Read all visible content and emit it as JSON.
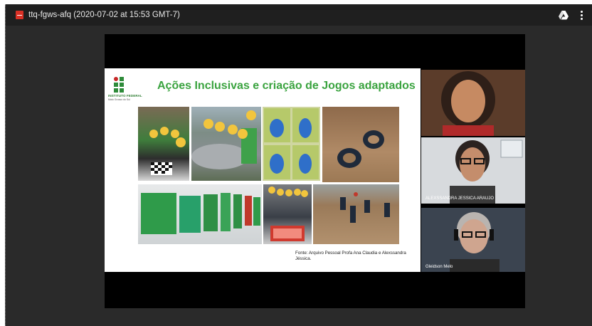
{
  "window": {
    "title": "ttq-fgws-afq (2020-07-02 at 15:53 GMT-7)",
    "file_icon": "recording-file-icon",
    "drive_icon": "google-drive-icon",
    "more_icon": "more-vert-icon"
  },
  "slide": {
    "logo_text": "INSTITUTO FEDERAL",
    "logo_subtext": "Mato Grosso do Sul",
    "title": "Ações  Inclusivas e criação de Jogos adaptados",
    "caption": "Fonte: Arquivo Pessoal Profa Ana Claudia e  Alexssandra Jéssica."
  },
  "participants": [
    {
      "name": "",
      "tile_color": "#6b4a35"
    },
    {
      "name": "ALEXSSANDRA JESSICA ARAUJO",
      "tile_color": "#c7ccd1"
    },
    {
      "name": "Gleidson Melo",
      "tile_color": "#3b4450"
    }
  ]
}
